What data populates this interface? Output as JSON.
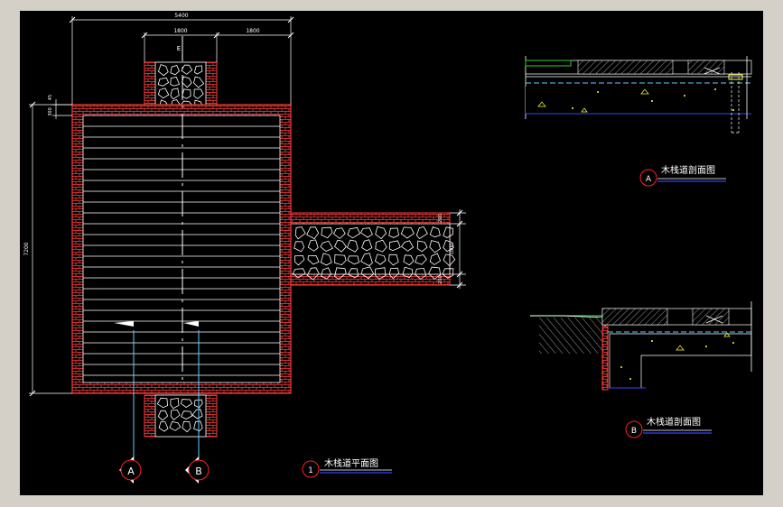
{
  "drawing": {
    "dimensions": {
      "overall_width": "5400",
      "left_span": "1800",
      "right_span": "1800",
      "grid_mark": "E",
      "top_offset_a": "300",
      "top_offset_b": "45",
      "overall_height": "7200",
      "branch_top": "200",
      "branch_middle": "1800",
      "branch_bottom": "200"
    },
    "titles": {
      "plan_number": "1",
      "plan_title": "木栈道平面图",
      "section_a_marker": "A",
      "section_a_title": "木栈道剖面图",
      "section_b_marker": "B",
      "section_b_title": "木栈道剖面图"
    },
    "section_callouts": {
      "left_marker": "A",
      "right_marker": "B"
    },
    "colors": {
      "background": "#000000",
      "frame": "#d4d0c8",
      "brick": "#ff3b3b",
      "stone": "#ffffff",
      "dimension": "#ffffff",
      "section_line": "#66ccff",
      "title_underline": "#3344ff",
      "marker_circle": "#ff2222",
      "grass": "#33cc33",
      "yellow": "#ffff33"
    }
  }
}
